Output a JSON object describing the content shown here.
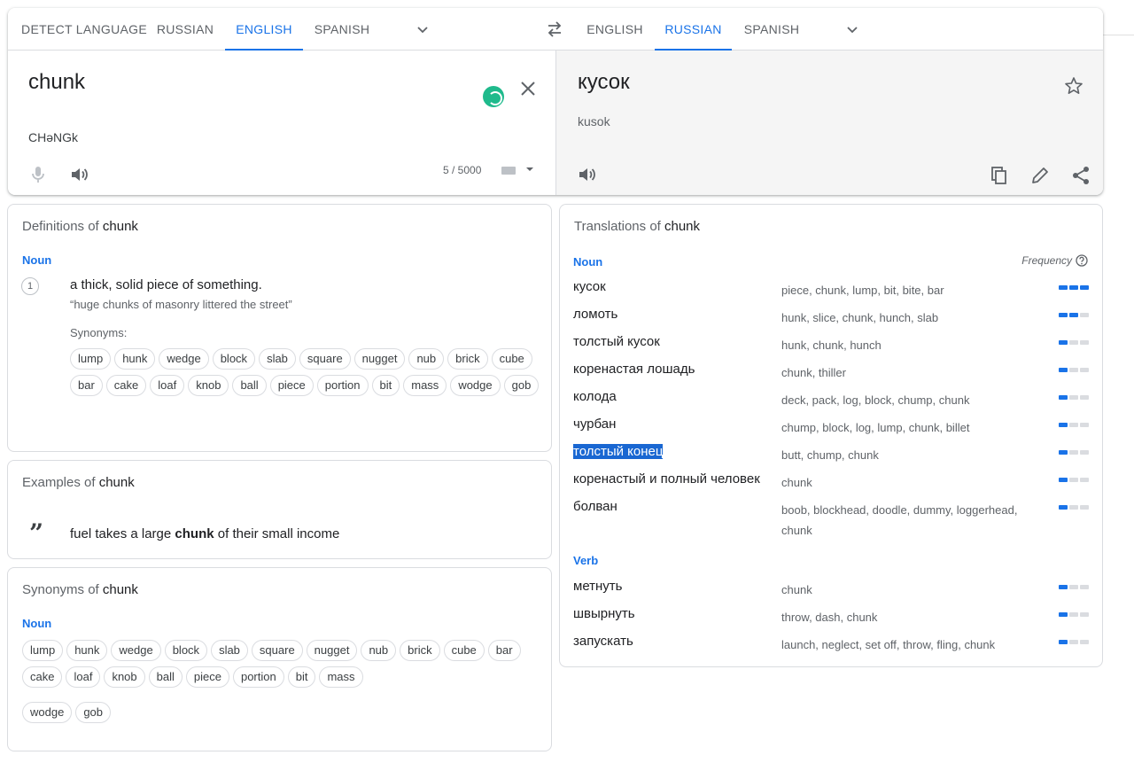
{
  "source_tabs": [
    "DETECT LANGUAGE",
    "RUSSIAN",
    "ENGLISH",
    "SPANISH"
  ],
  "source_active": "ENGLISH",
  "target_tabs": [
    "ENGLISH",
    "RUSSIAN",
    "SPANISH"
  ],
  "target_active": "RUSSIAN",
  "source": {
    "text": "chunk",
    "phonetic": "CHəNGk",
    "counter": "5 / 5000"
  },
  "target": {
    "text": "кусок",
    "transliteration": "kusok"
  },
  "definitions": {
    "title_prefix": "Definitions of ",
    "word": "chunk",
    "pos": "Noun",
    "number": "1",
    "definition": "a thick, solid piece of something.",
    "example": "“huge chunks of masonry littered the street”",
    "synonyms_label": "Synonyms:",
    "synonyms": [
      "lump",
      "hunk",
      "wedge",
      "block",
      "slab",
      "square",
      "nugget",
      "nub",
      "brick",
      "cube",
      "bar",
      "cake",
      "loaf",
      "knob",
      "ball",
      "piece",
      "portion",
      "bit",
      "mass",
      "wodge",
      "gob"
    ]
  },
  "examples": {
    "title_prefix": "Examples of ",
    "word": "chunk",
    "sentence_before": "fuel takes a large ",
    "sentence_bold": "chunk",
    "sentence_after": " of their small income"
  },
  "synonyms_card": {
    "title_prefix": "Synonyms of ",
    "word": "chunk",
    "pos": "Noun",
    "group1": [
      "lump",
      "hunk",
      "wedge",
      "block",
      "slab",
      "square",
      "nugget",
      "nub",
      "brick",
      "cube",
      "bar",
      "cake",
      "loaf",
      "knob",
      "ball",
      "piece",
      "portion",
      "bit",
      "mass"
    ],
    "group2": [
      "wodge",
      "gob"
    ]
  },
  "translations": {
    "title_prefix": "Translations of ",
    "word": "chunk",
    "frequency_label": "Frequency",
    "noun_label": "Noun",
    "verb_label": "Verb",
    "nouns": [
      {
        "word": "кусок",
        "reverse": "piece, chunk, lump, bit, bite, bar",
        "freq": 3
      },
      {
        "word": "ломоть",
        "reverse": "hunk, slice, chunk, hunch, slab",
        "freq": 2
      },
      {
        "word": "толстый кусок",
        "reverse": "hunk, chunk, hunch",
        "freq": 1
      },
      {
        "word": "коренастая лошадь",
        "reverse": "chunk, thiller",
        "freq": 1
      },
      {
        "word": "колода",
        "reverse": "deck, pack, log, block, chump, chunk",
        "freq": 1
      },
      {
        "word": "чурбан",
        "reverse": "chump, block, log, lump, chunk, billet",
        "freq": 1
      },
      {
        "word": "толстый конец",
        "reverse": "butt, chump, chunk",
        "freq": 1,
        "highlighted": true
      },
      {
        "word": "коренастый и полный человек",
        "reverse": "chunk",
        "freq": 1
      },
      {
        "word": "болван",
        "reverse": "boob, blockhead, doodle, dummy, loggerhead, chunk",
        "freq": 1
      }
    ],
    "verbs": [
      {
        "word": "метнуть",
        "reverse": "chunk",
        "freq": 1
      },
      {
        "word": "швырнуть",
        "reverse": "throw, dash, chunk",
        "freq": 1
      },
      {
        "word": "запускать",
        "reverse": "launch, neglect, set off, throw, fling, chunk",
        "freq": 1
      }
    ]
  },
  "colors": {
    "accent": "#1a73e8",
    "spinner": "#1fba8c",
    "highlight": "#1967d2"
  }
}
